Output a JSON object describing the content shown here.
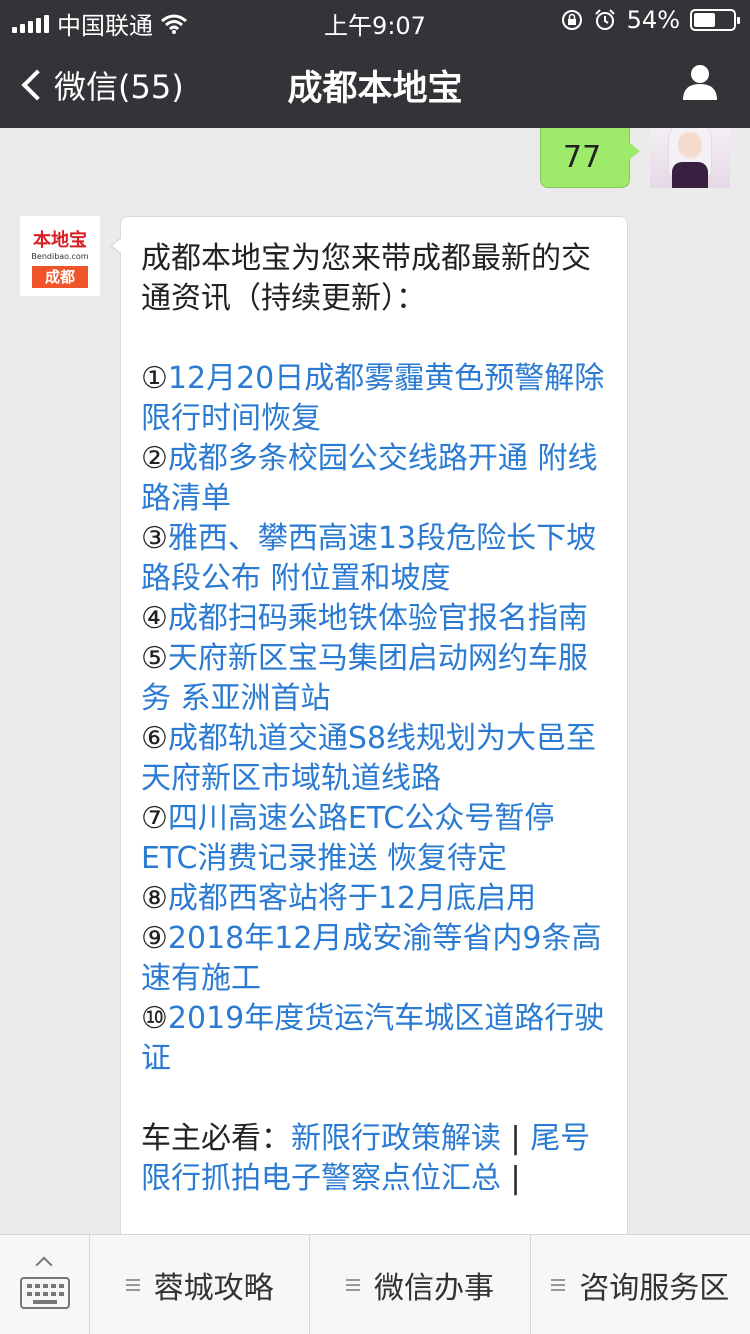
{
  "status_bar": {
    "carrier": "中国联通",
    "time": "上午9:07",
    "battery": "54%",
    "battery_level": 0.54
  },
  "nav": {
    "back_label": "微信(55)",
    "title": "成都本地宝",
    "profile_icon": "person-icon"
  },
  "chat": {
    "my_message": "77",
    "bot_avatar": {
      "logo_top": "本地宝",
      "logo_site": "Bendibao.com",
      "logo_city": "成都"
    },
    "message": {
      "intro": "成都本地宝为您来带成都最新的交通资讯（持续更新）：",
      "items": [
        {
          "num": "①",
          "text": "12月20日成都雾霾黄色预警解除 限行时间恢复"
        },
        {
          "num": "②",
          "text": "成都多条校园公交线路开通 附线路清单"
        },
        {
          "num": "③",
          "text": "雅西、攀西高速13段危险长下坡路段公布 附位置和坡度"
        },
        {
          "num": "④",
          "text": "成都扫码乘地铁体验官报名指南"
        },
        {
          "num": "⑤",
          "text": "天府新区宝马集团启动网约车服务 系亚洲首站"
        },
        {
          "num": "⑥",
          "text": "成都轨道交通S8线规划为大邑至天府新区市域轨道线路"
        },
        {
          "num": "⑦",
          "text": "四川高速公路ETC公众号暂停ETC消费记录推送 恢复待定"
        },
        {
          "num": "⑧",
          "text": "成都西客站将于12月底启用"
        },
        {
          "num": "⑨",
          "text": "2018年12月成安渝等省内9条高速有施工"
        },
        {
          "num": "⑩",
          "text": "2019年度货运汽车城区道路行驶证"
        }
      ],
      "footer_label": "车主必看：",
      "footer_links": [
        "新限行政策解读",
        "尾号限行抓拍电子警察点位汇总"
      ],
      "footer_sep": " | "
    }
  },
  "bottom_menu": {
    "keyboard_icon": "keyboard-icon",
    "items": [
      "蓉城攻略",
      "微信办事",
      "咨询服务区"
    ]
  }
}
